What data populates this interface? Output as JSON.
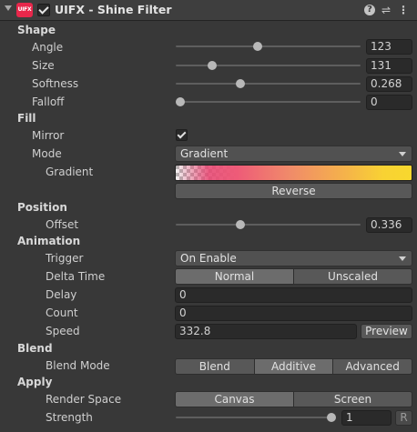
{
  "header": {
    "logo_text": "UIFX",
    "title": "UIFX - Shine Filter",
    "enabled": true,
    "icons": [
      "help-icon",
      "settings-sliders-icon",
      "more-vert-icon"
    ]
  },
  "shape": {
    "title": "Shape",
    "angle": {
      "label": "Angle",
      "value": "123",
      "fraction": 0.44
    },
    "size": {
      "label": "Size",
      "value": "131",
      "fraction": 0.18
    },
    "softness": {
      "label": "Softness",
      "value": "0.268",
      "fraction": 0.34
    },
    "falloff": {
      "label": "Falloff",
      "value": "0",
      "fraction": 0.0
    }
  },
  "fill": {
    "title": "Fill",
    "mirror": {
      "label": "Mirror",
      "checked": true
    },
    "mode": {
      "label": "Mode",
      "value": "Gradient"
    },
    "gradient": {
      "label": "Gradient"
    },
    "reverse_label": "Reverse"
  },
  "position": {
    "title": "Position",
    "offset": {
      "label": "Offset",
      "value": "0.336",
      "fraction": 0.34
    }
  },
  "animation": {
    "title": "Animation",
    "trigger": {
      "label": "Trigger",
      "value": "On Enable"
    },
    "delta_time": {
      "label": "Delta Time",
      "options": [
        "Normal",
        "Unscaled"
      ],
      "selected": "Normal"
    },
    "delay": {
      "label": "Delay",
      "value": "0"
    },
    "count": {
      "label": "Count",
      "value": "0"
    },
    "speed": {
      "label": "Speed",
      "value": "332.8"
    },
    "preview_label": "Preview"
  },
  "blend": {
    "title": "Blend",
    "mode": {
      "label": "Blend Mode",
      "options": [
        "Blend",
        "Additive",
        "Advanced"
      ],
      "selected": "Additive"
    }
  },
  "apply": {
    "title": "Apply",
    "render_space": {
      "label": "Render Space",
      "options": [
        "Canvas",
        "Screen"
      ],
      "selected": "Canvas"
    },
    "strength": {
      "label": "Strength",
      "value": "1",
      "fraction": 1.0,
      "reset_label": "R"
    }
  }
}
